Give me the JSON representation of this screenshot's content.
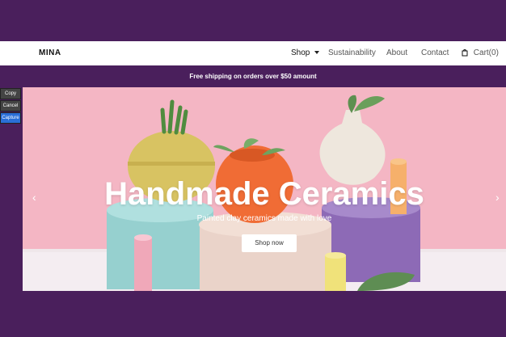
{
  "nav": {
    "brand": "MINA",
    "items": [
      "Shop",
      "Sustainability",
      "About",
      "Contact"
    ],
    "cart": "Cart(0)"
  },
  "promo": {
    "text": "Free shipping on orders over $50 amount"
  },
  "hero": {
    "title": "Handmade Ceramics",
    "subtitle": "Painted clay ceramics made with love",
    "button": "Shop now",
    "prev": "‹",
    "next": "›"
  },
  "tools": [
    "Copy",
    "Cancel",
    "Capture"
  ],
  "icons": {
    "shop_caret": "chevron-down-icon",
    "cart": "shopping-bag-icon"
  },
  "colors": {
    "purple": "#4a1f5c",
    "hero_pink": "#f2b7c4",
    "pot_yellow": "#d8c362",
    "pot_orange": "#f06c35",
    "vase_cream": "#eee7dd",
    "cylinder_purple": "#8d6ab6"
  }
}
